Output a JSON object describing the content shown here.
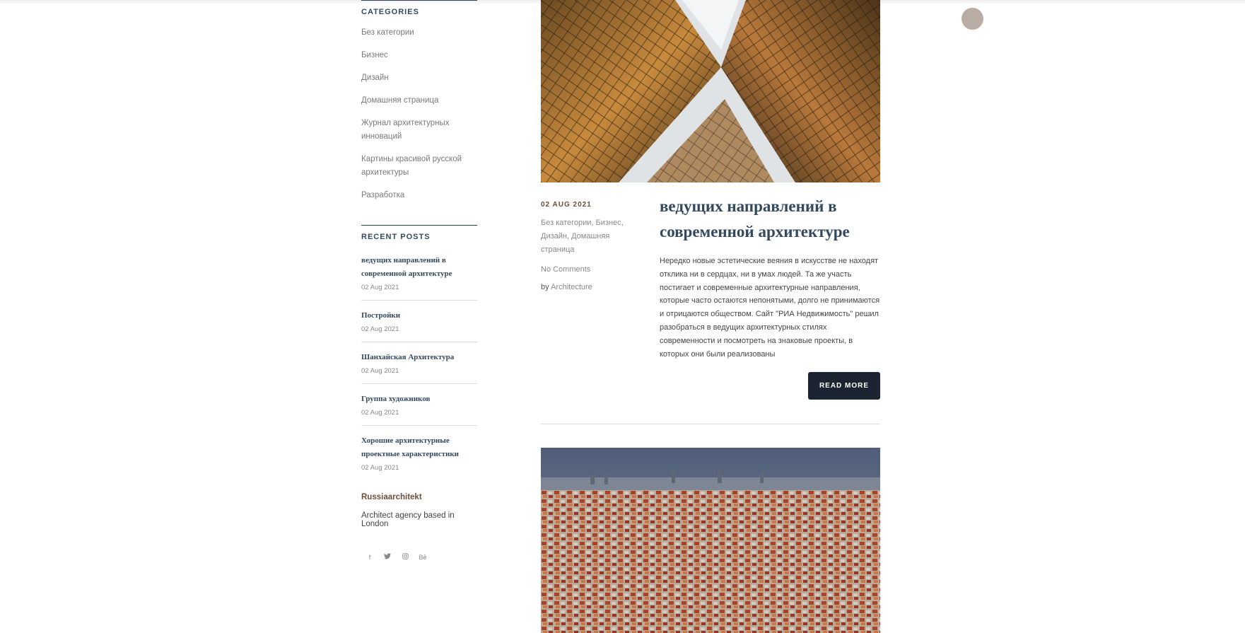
{
  "sidebar": {
    "categories_title": "Categories",
    "categories": [
      {
        "label": "Без категории"
      },
      {
        "label": "Бизнес"
      },
      {
        "label": "Дизайн"
      },
      {
        "label": "Домашняя страница"
      },
      {
        "label": "Журнал архитектурных инноваций"
      },
      {
        "label": "Картины красивой русской архитектуры"
      },
      {
        "label": "Разработка"
      }
    ],
    "recent_title": "Recent Posts",
    "recent_posts": [
      {
        "title": "ведущих направлений в современной архитектуре",
        "date": "02 Aug 2021"
      },
      {
        "title": "Постройки",
        "date": "02 Aug 2021"
      },
      {
        "title": "Шанхайская Архитектура",
        "date": "02 Aug 2021"
      },
      {
        "title": "Группа художников",
        "date": "02 Aug 2021"
      },
      {
        "title": "Хорошие архитектурные проектные характеристики",
        "date": "02 Aug 2021"
      }
    ],
    "site_name": "Russiaarchitekt",
    "site_description": "Architect agency based in London",
    "social_icons": [
      "facebook-icon",
      "twitter-icon",
      "instagram-icon",
      "behance-icon"
    ],
    "social_glyphs": {
      "facebook": "f",
      "twitter": "🐦",
      "instagram": "◎",
      "behance": "Bē"
    }
  },
  "post": {
    "date": "02 AUG 2021",
    "categories": [
      "Без категории",
      "Бизнес",
      "Дизайн",
      "Домашняя страница"
    ],
    "comments": "No Comments",
    "by_prefix": "by",
    "author": "Architecture",
    "title": "ведущих направлений в современной архитектуре",
    "excerpt": "Нередко новые эстетические веяния в искусстве не находят отклика ни в сердцах, ни в умах людей. Та же участь постигает и современные архитектурные направления, которые часто остаются непонятыми, долго не принимаются и отрицаются обществом. Сайт \"РИА Недвижимость\" решил разобраться в ведущих архитектурных стилях современности и посмотреть на знаковые проекты, в которых они были реализованы",
    "read_more": "READ MORE"
  },
  "colors": {
    "accent_dark": "#1c2431",
    "title_blue": "#34495e",
    "meta_brown": "#6b4f3a",
    "float_button": "#b8aca3"
  }
}
